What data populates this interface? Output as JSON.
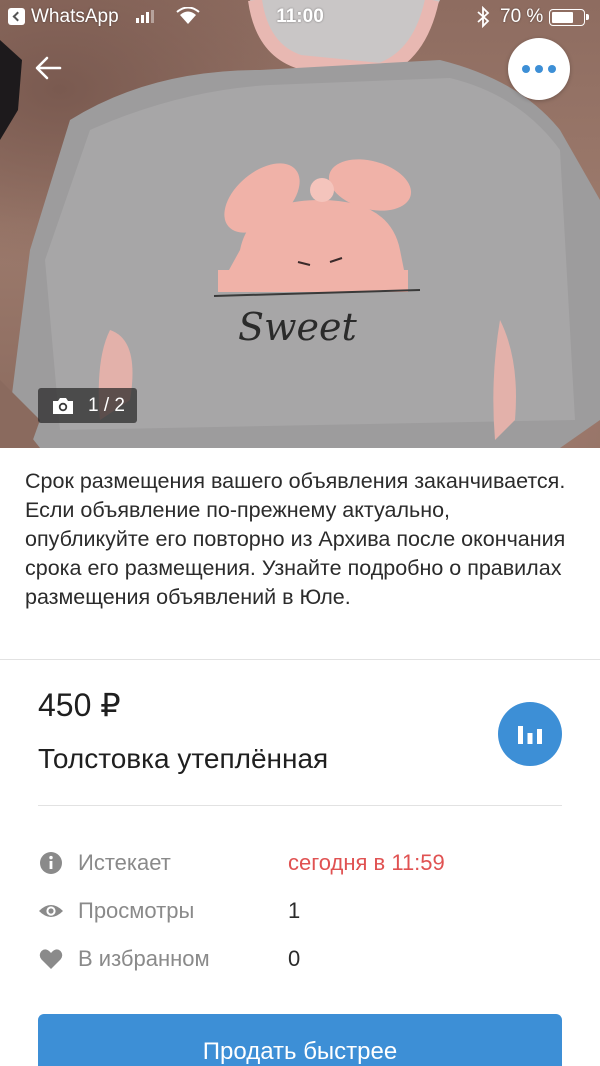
{
  "status_bar": {
    "app": "WhatsApp",
    "time": "11:00",
    "battery": "70 %",
    "battery_level": 0.7
  },
  "photo": {
    "counter": "1 / 2",
    "print_text": "Sweet"
  },
  "notice": "Срок размещения вашего объявления заканчивается. Если объявление по-прежнему актуально, опубликуйте его повторно из Архива после окончания срока его размещения. Узнайте подробно о правилах размещения объявлений в Юле.",
  "product": {
    "price": "450 ₽",
    "title": "Толстовка утеплённая"
  },
  "info": {
    "expires_label": "Истекает",
    "expires_value": "сегодня в 11:59",
    "views_label": "Просмотры",
    "views_value": "1",
    "favorites_label": "В избранном",
    "favorites_value": "0"
  },
  "actions": {
    "sell_faster": "Продать быстрее"
  },
  "colors": {
    "accent": "#3d8fd6",
    "warning": "#e05252"
  }
}
